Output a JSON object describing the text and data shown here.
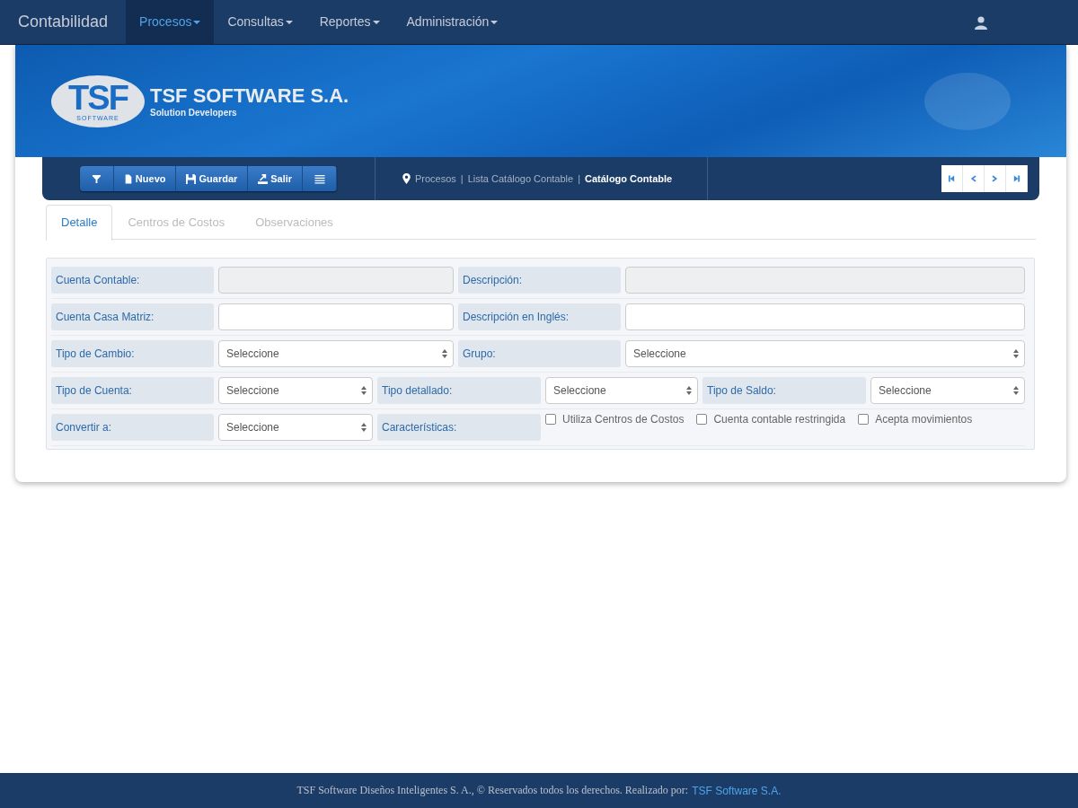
{
  "navbar": {
    "brand": "Contabilidad",
    "menus": [
      {
        "label": "Procesos",
        "selected": true
      },
      {
        "label": "Consultas",
        "selected": false
      },
      {
        "label": "Reportes",
        "selected": false
      },
      {
        "label": "Administración",
        "selected": false
      }
    ]
  },
  "banner": {
    "logo_mark": "TSF",
    "logo_sub": "SOFTWARE",
    "company": "TSF SOFTWARE S.A.",
    "tagline": "Solution Developers"
  },
  "toolbar": {
    "buttons": [
      {
        "kind": "filter"
      },
      {
        "kind": "new",
        "label": "Nuevo"
      },
      {
        "kind": "save",
        "label": "Guardar"
      },
      {
        "kind": "exit",
        "label": "Salir"
      },
      {
        "kind": "list"
      }
    ],
    "breadcrumb": {
      "separator": "|",
      "items": [
        {
          "label": "Procesos",
          "current": false
        },
        {
          "label": "Lista Catálogo Contable",
          "current": false
        },
        {
          "label": "Catálogo Contable",
          "current": true
        }
      ]
    },
    "pager": [
      {
        "kind": "first"
      },
      {
        "kind": "prev"
      },
      {
        "kind": "next"
      },
      {
        "kind": "last"
      }
    ]
  },
  "tabs": [
    {
      "label": "Detalle",
      "selected": true
    },
    {
      "label": "Centros de Costos",
      "selected": false
    },
    {
      "label": "Observaciones",
      "selected": false
    }
  ],
  "form": {
    "rows": [
      {
        "kind": "wide",
        "fields": [
          {
            "label": "Cuenta Contable:",
            "kind": "input",
            "disabled": true
          },
          {
            "label": "Descripción:",
            "kind": "input",
            "disabled": true
          }
        ]
      },
      {
        "kind": "wide",
        "fields": [
          {
            "label": "Cuenta Casa Matriz:",
            "kind": "input",
            "disabled": false
          },
          {
            "label": "Descripción en Inglés:",
            "kind": "input",
            "disabled": false
          }
        ]
      },
      {
        "kind": "wide",
        "fields": [
          {
            "label": "Tipo de Cambio:",
            "kind": "select",
            "value": "Seleccione"
          },
          {
            "label": "Grupo:",
            "kind": "select",
            "value": "Seleccione"
          }
        ]
      },
      {
        "kind": "narrow",
        "fields": [
          {
            "label": "Tipo de Cuenta:",
            "kind": "select",
            "value": "Seleccione"
          },
          {
            "label": "Tipo detallado:",
            "kind": "select",
            "value": "Seleccione"
          },
          {
            "label": "Tipo de Saldo:",
            "kind": "select",
            "value": "Seleccione"
          }
        ]
      },
      {
        "kind": "narrow",
        "fields": [
          {
            "label": "Convertir a:",
            "kind": "select",
            "value": "Seleccione"
          },
          {
            "label": "Características:",
            "kind": "checks",
            "options": [
              {
                "label": "Utiliza Centros de Costos",
                "checked": false
              },
              {
                "label": "Cuenta contable restringida",
                "checked": false
              },
              {
                "label": "Acepta movimientos",
                "checked": false
              }
            ]
          }
        ]
      }
    ]
  },
  "footer": {
    "text": "TSF Software Diseños Inteligentes S. A., © Reservados todos los derechos. Realizado por:",
    "link": "TSF Software S.A."
  }
}
